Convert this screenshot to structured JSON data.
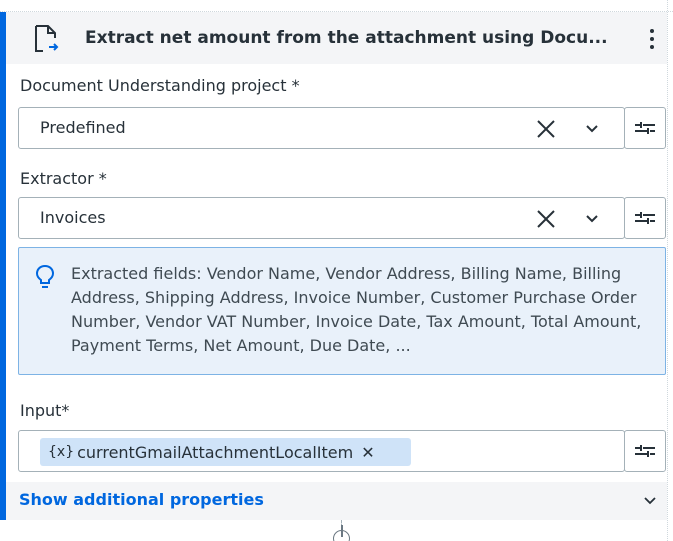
{
  "activity": {
    "title": "Extract net amount from the attachment using Docu...",
    "icon": "document-export-icon",
    "menu_icon": "kebab-menu-icon"
  },
  "du_project": {
    "label": "Document Understanding project *",
    "value": "Predefined"
  },
  "extractor": {
    "label": "Extractor *",
    "value": "Invoices"
  },
  "info": {
    "icon": "lightbulb-icon",
    "text": "Extracted fields: Vendor Name, Vendor Address, Billing Name, Billing Address, Shipping Address, Invoice Number, Customer Purchase Order Number, Vendor VAT Number, Invoice Date, Tax Amount, Total Amount, Payment Terms, Net Amount, Due Date, ..."
  },
  "input": {
    "label": "Input*",
    "chip_prefix": "{x}",
    "chip_value": "currentGmailAttachmentLocalItem",
    "chip_remove": "✕"
  },
  "additional": {
    "label": "Show additional properties"
  },
  "colors": {
    "accent": "#0067df",
    "info_bg": "#e9f1fa",
    "chip_bg": "#cfe3f8"
  }
}
